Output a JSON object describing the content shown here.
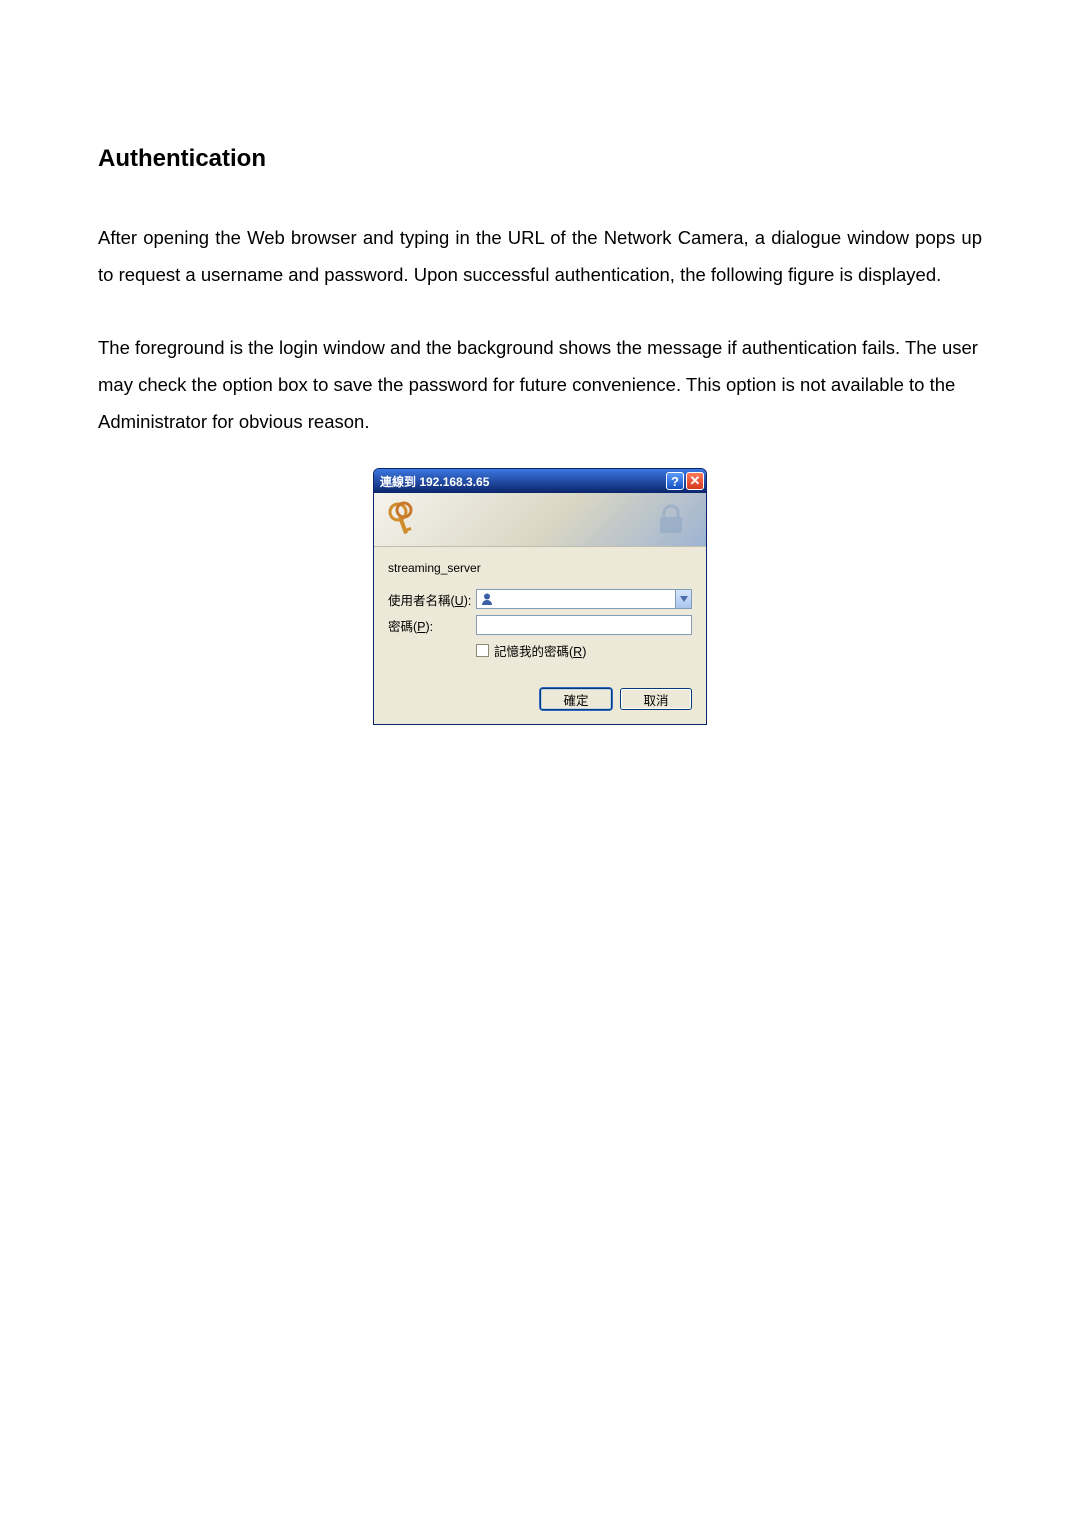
{
  "heading": "Authentication",
  "paragraph1": "After opening the Web browser and typing in the URL of the Network Camera, a dialogue window pops up to request a username and password. Upon successful authentication, the following figure is displayed.",
  "paragraph2": "The foreground is the login window and the background shows the message if authentication fails. The user may check the option box to save the password for future convenience.    This option is not available to the Administrator for obvious reason.",
  "dialog": {
    "title": "連線到 192.168.3.65",
    "realm": "streaming_server",
    "username_label_pre": "使用者名稱(",
    "username_label_key": "U",
    "username_label_post": "):",
    "password_label_pre": "密碼(",
    "password_label_key": "P",
    "password_label_post": "):",
    "remember_label_pre": "記憶我的密碼(",
    "remember_label_key": "R",
    "remember_label_post": ")",
    "ok_label": "確定",
    "cancel_label": "取消",
    "username_value": "",
    "password_value": ""
  }
}
